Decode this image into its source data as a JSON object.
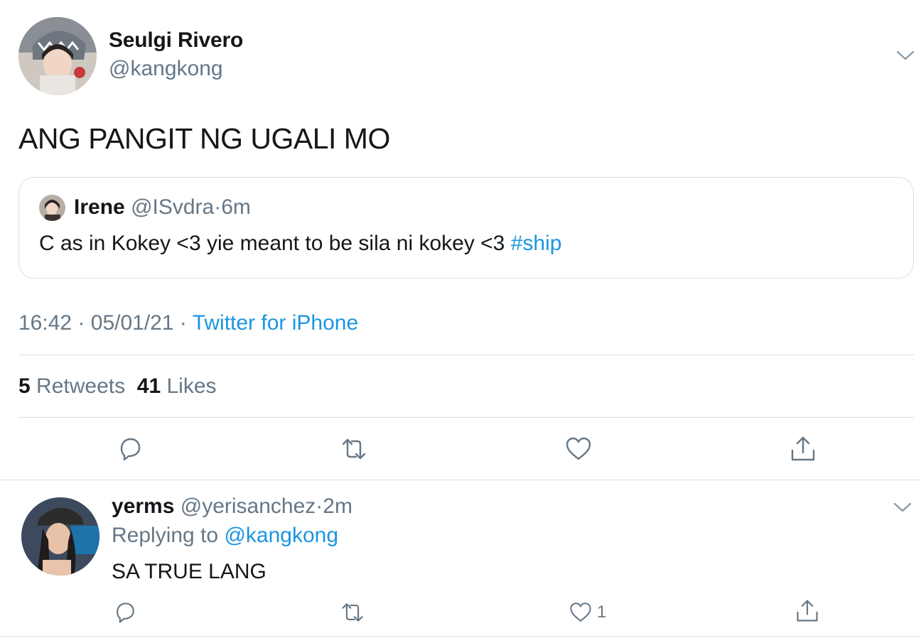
{
  "tweet": {
    "author_name": "Seulgi Rivero",
    "author_handle": "@kangkong",
    "text": "ANG PANGIT NG UGALI MO",
    "quote": {
      "name": "Irene",
      "handle": "@ISvdra",
      "separator": "·",
      "time": "6m",
      "text": "C as in Kokey <3 yie meant to be sila ni kokey <3 ",
      "hashtag": "#ship"
    },
    "time": "16:42",
    "date": "05/01/21",
    "separator": "·",
    "source": "Twitter for iPhone",
    "retweets_count": "5",
    "retweets_label": "Retweets",
    "likes_count": "41",
    "likes_label": "Likes"
  },
  "reply": {
    "name": "yerms",
    "handle": "@yerisanchez",
    "separator": "·",
    "time": "2m",
    "replying_prefix": "Replying to",
    "replying_to": "@kangkong",
    "text": "SA TRUE LANG",
    "like_count": "1"
  },
  "icons": {
    "action_color": "#657786",
    "link_color": "#1b95e0",
    "reply": "reply-icon",
    "retweet": "retweet-icon",
    "like": "heart-icon",
    "share": "share-icon",
    "menu": "chevron-down-icon"
  }
}
